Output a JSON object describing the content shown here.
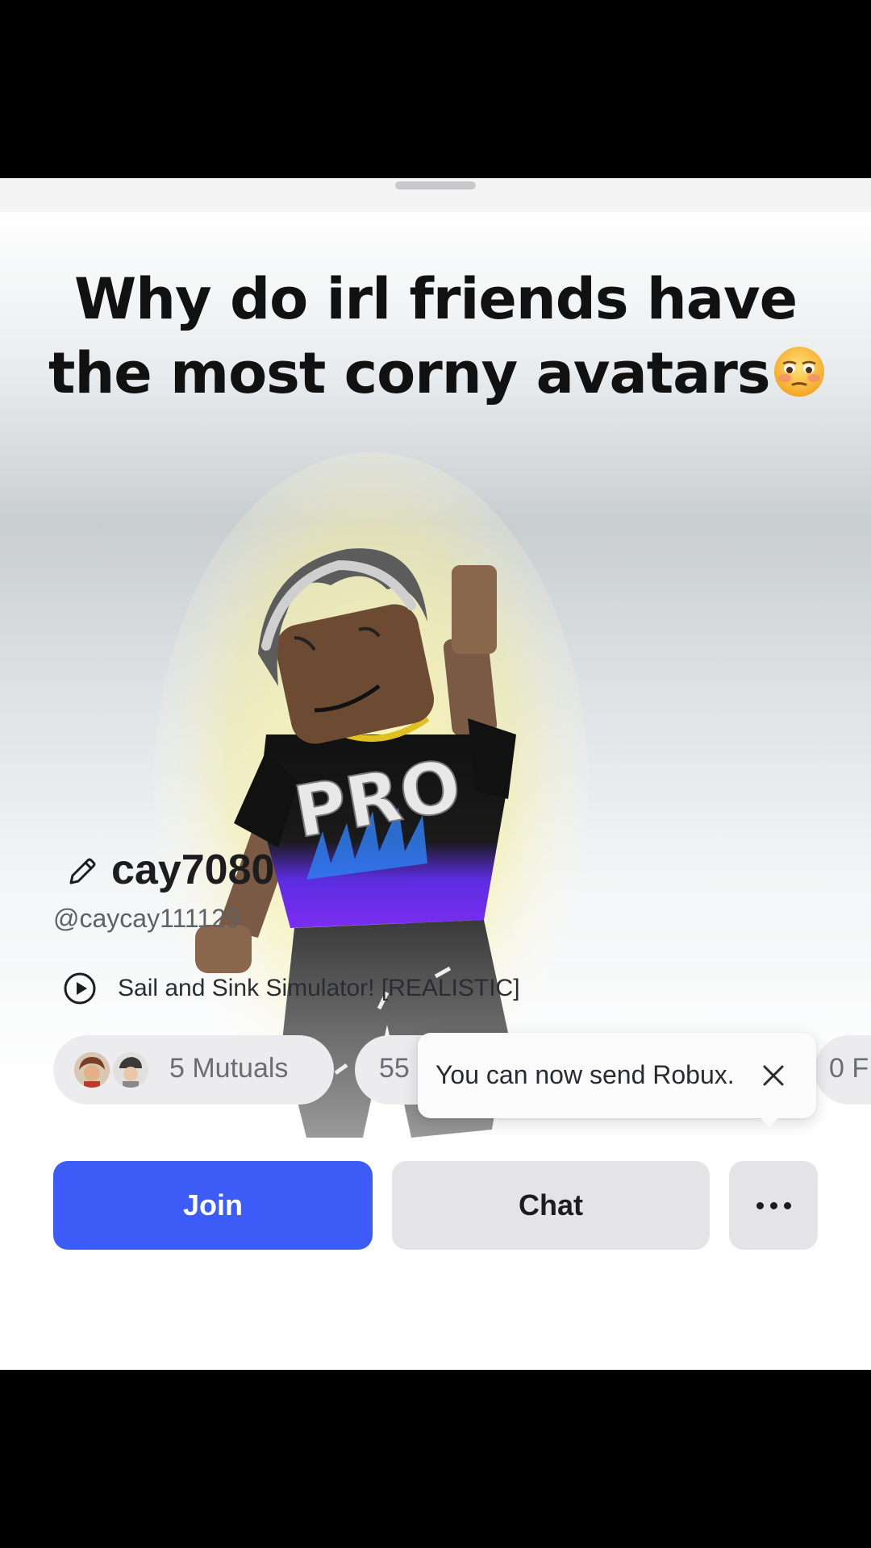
{
  "caption": {
    "line1": "Why do irl friends have",
    "line2": "the most corny avatars",
    "emoji_icon": "flushed-face-emoji"
  },
  "profile": {
    "display_name": "cay7080",
    "username": "@caycay111129",
    "status_game": "Sail and Sink Simulator! [REALISTIC]",
    "shirt_text": "PRO"
  },
  "stats": {
    "mutuals_label": "5 Mutuals",
    "friends_label_partial": "55",
    "following_label_partial": "0 F"
  },
  "tooltip": {
    "text": "You can now send Robux.",
    "close_icon": "close-icon"
  },
  "actions": {
    "join_label": "Join",
    "chat_label": "Chat",
    "more_icon": "more-dots-icon"
  },
  "colors": {
    "join_button": "#3d5bf6",
    "secondary_button": "#e4e4e7",
    "background": "#ffffff",
    "letterbox": "#000000"
  }
}
